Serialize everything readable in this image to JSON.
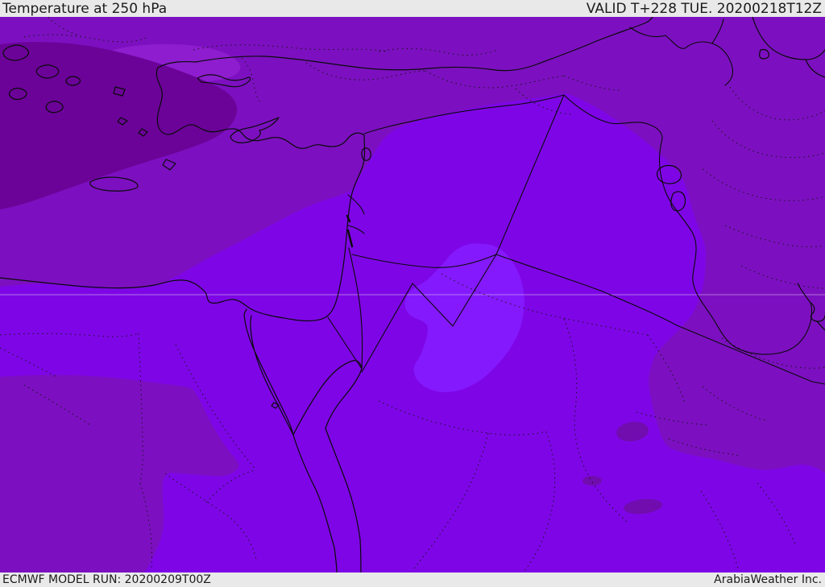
{
  "header": {
    "title": "Temperature at 250 hPa",
    "valid_label": "VALID T+228 TUE. 20200218T12Z"
  },
  "footer": {
    "model_run_label": "ECMWF MODEL RUN: 20200209T00Z",
    "brand_label": "ArabiaWeather Inc."
  },
  "map": {
    "colors": {
      "band_magenta_base": "#7c10c0",
      "band_violet_cold": "#7e06e6",
      "band_coldest_pale": "#8519fd",
      "band_warm_dark_wedge": "#6b0398",
      "band_lavender_light": "#8e1dcf",
      "band_dark_spot": "#710cae",
      "coast_border": "#0a0a0a",
      "admin_dotted": "#141414",
      "gridline": "#d9c9ea",
      "bar_background": "#e9e9e9",
      "bar_text": "#1b1b1b"
    }
  }
}
